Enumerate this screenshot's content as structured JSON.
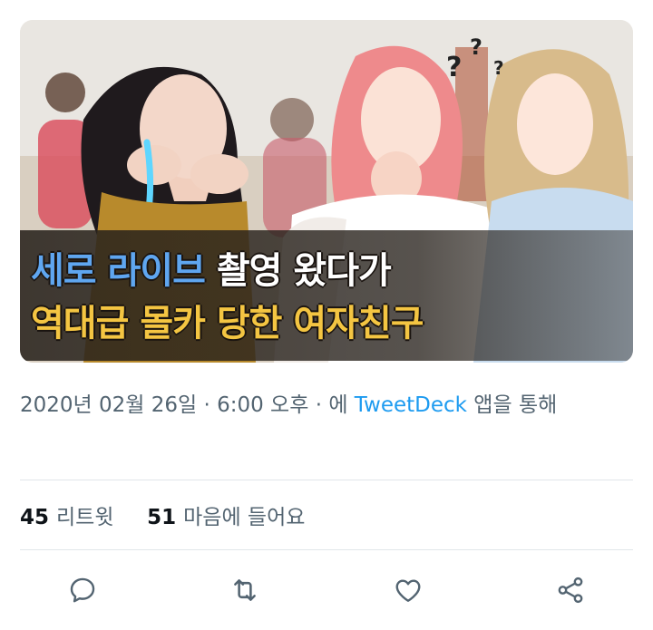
{
  "media": {
    "caption_line1_blue": "세로 라이브",
    "caption_line1_white": " 촬영 왔다가",
    "caption_line2": "역대급 몰카 당한 여자친구"
  },
  "meta": {
    "timestamp": "2020년 02월 26일 · 6:00 오후 · 에 ",
    "source": "TweetDeck",
    "suffix": " 앱을 통해"
  },
  "stats": {
    "retweets_count": "45",
    "retweets_label": "리트윗",
    "likes_count": "51",
    "likes_label": "마음에 들어요"
  },
  "actions": {
    "icons": [
      "reply-icon",
      "retweet-icon",
      "like-icon",
      "share-icon"
    ]
  },
  "colors": {
    "link": "#1d9bf0",
    "secondary_text": "#536471",
    "caption_yellow": "#f4c542",
    "caption_blue": "#5fa6f0"
  }
}
